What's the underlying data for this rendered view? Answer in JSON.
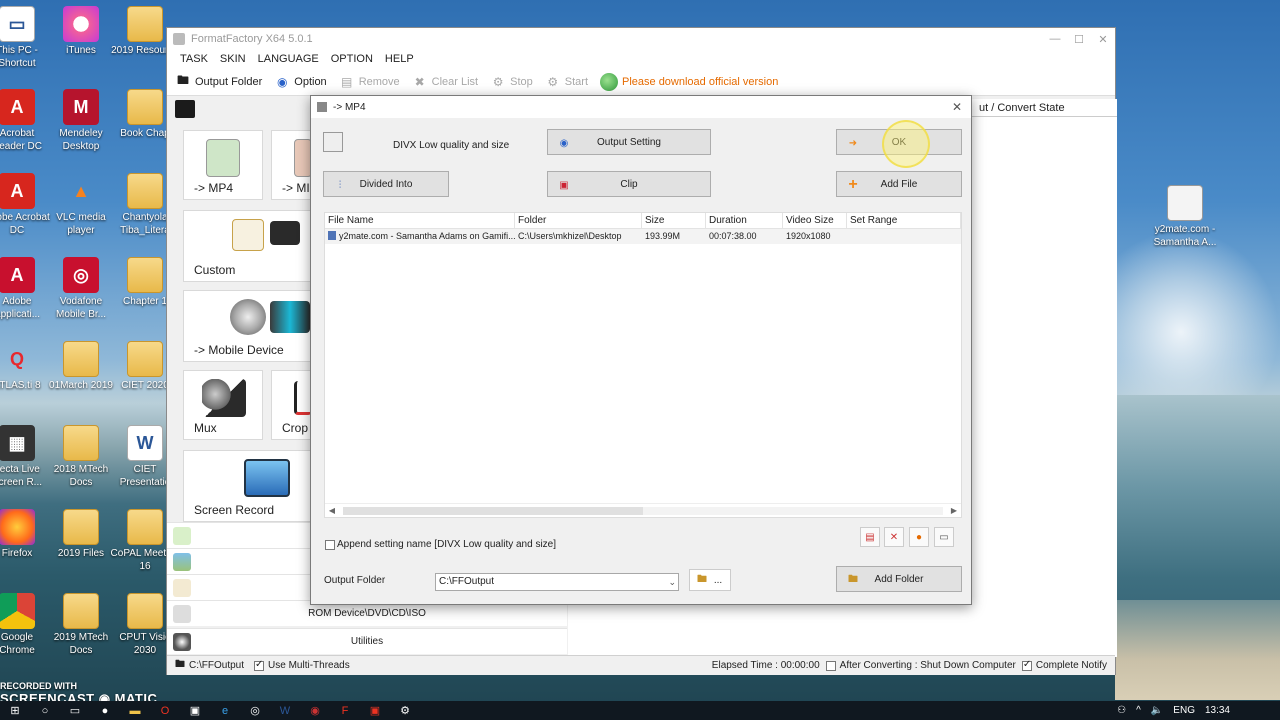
{
  "desktop": {
    "icons": [
      {
        "label": "This PC - Shortcut",
        "glyph": "▭",
        "kind": "g-doc"
      },
      {
        "label": "iTunes",
        "glyph": "♪",
        "kind": "g-itunes"
      },
      {
        "label": "2019 Resource",
        "glyph": "",
        "kind": "g-folder"
      },
      {
        "label": "Acrobat Reader DC",
        "glyph": "A",
        "kind": "g-pdf"
      },
      {
        "label": "Mendeley Desktop",
        "glyph": "M",
        "kind": "g-mendeley"
      },
      {
        "label": "Book Chap",
        "glyph": "",
        "kind": "g-folder"
      },
      {
        "label": "Adobe Acrobat DC",
        "glyph": "A",
        "kind": "g-pdf"
      },
      {
        "label": "VLC media player",
        "glyph": "▲",
        "kind": "g-vlc"
      },
      {
        "label": "Chantyola Tiba_Litera",
        "glyph": "",
        "kind": "g-folder"
      },
      {
        "label": "Adobe Applicati...",
        "glyph": "A",
        "kind": "g-red"
      },
      {
        "label": "Vodafone Mobile Br...",
        "glyph": "◎",
        "kind": "g-red"
      },
      {
        "label": "Chapter 1",
        "glyph": "",
        "kind": "g-folder"
      },
      {
        "label": "ATLAS.ti 8",
        "glyph": "Q",
        "kind": "g-atlas"
      },
      {
        "label": "01March 2019",
        "glyph": "",
        "kind": "g-folder"
      },
      {
        "label": "CIET 2020",
        "glyph": "",
        "kind": "g-folder"
      },
      {
        "label": "Lecta Live Screen R...",
        "glyph": "▦",
        "kind": "g-film"
      },
      {
        "label": "2018 MTech Docs",
        "glyph": "",
        "kind": "g-folder"
      },
      {
        "label": "CIET Presentatio",
        "glyph": "W",
        "kind": "g-doc"
      },
      {
        "label": "Firefox",
        "glyph": "",
        "kind": "g-firefox"
      },
      {
        "label": "2019 Files",
        "glyph": "",
        "kind": "g-folder"
      },
      {
        "label": "CoPAL Meeting 16",
        "glyph": "",
        "kind": "g-folder"
      },
      {
        "label": "Google Chrome",
        "glyph": "",
        "kind": "g-chrome"
      },
      {
        "label": "2019 MTech Docs",
        "glyph": "",
        "kind": "g-folder"
      },
      {
        "label": "CPUT Visio 2030",
        "glyph": "",
        "kind": "g-folder"
      }
    ],
    "right_icon_label": "y2mate.com - Samantha A..."
  },
  "ff": {
    "title": "FormatFactory X64 5.0.1",
    "menu": [
      "TASK",
      "SKIN",
      "LANGUAGE",
      "OPTION",
      "HELP"
    ],
    "toolbar": {
      "output_folder": "Output Folder",
      "option": "Option",
      "remove": "Remove",
      "clear_list": "Clear List",
      "stop": "Stop",
      "start": "Start",
      "download_msg": "Please download official version"
    },
    "tiles": {
      "mp4": "-> MP4",
      "mp4b": "-> MI",
      "custom": "Custom",
      "mobile": "-> Mobile Device",
      "mux": "Mux",
      "crop": "Crop",
      "screen_record": "Screen Record"
    },
    "bottom_lists": {
      "rom": "ROM Device\\DVD\\CD\\ISO",
      "utilities": "Utilities"
    },
    "right_header": "ut / Convert State",
    "status": {
      "folder": "C:\\FFOutput",
      "multi_threads": "Use Multi-Threads",
      "elapsed": "Elapsed Time : 00:00:00",
      "after_converting": "After Converting : Shut Down Computer",
      "complete_notify": "Complete Notify"
    }
  },
  "dialog": {
    "title": "-> MP4",
    "preset_label": "DIVX Low quality and size",
    "output_setting": "Output Setting",
    "ok": "OK",
    "divided_into": "Divided Into",
    "clip": "Clip",
    "add_file": "Add File",
    "columns": [
      "File Name",
      "Folder",
      "Size",
      "Duration",
      "Video Size",
      "Set Range"
    ],
    "rows": [
      [
        "y2mate.com - Samantha Adams on Gamifi...",
        "C:\\Users\\mkhizel\\Desktop",
        "193.99M",
        "00:07:38.00",
        "1920x1080",
        ""
      ]
    ],
    "append_label": "Append setting name [DIVX Low quality and size]",
    "output_folder_label": "Output Folder",
    "output_folder_value": "C:\\FFOutput",
    "browse_label": "...",
    "add_folder": "Add Folder"
  },
  "taskbar": {
    "time": "13:34",
    "lang": "ENG"
  },
  "watermark": {
    "line1": "RECORDED WITH",
    "line2": "SCREENCAST",
    "line3": "MATIC"
  }
}
